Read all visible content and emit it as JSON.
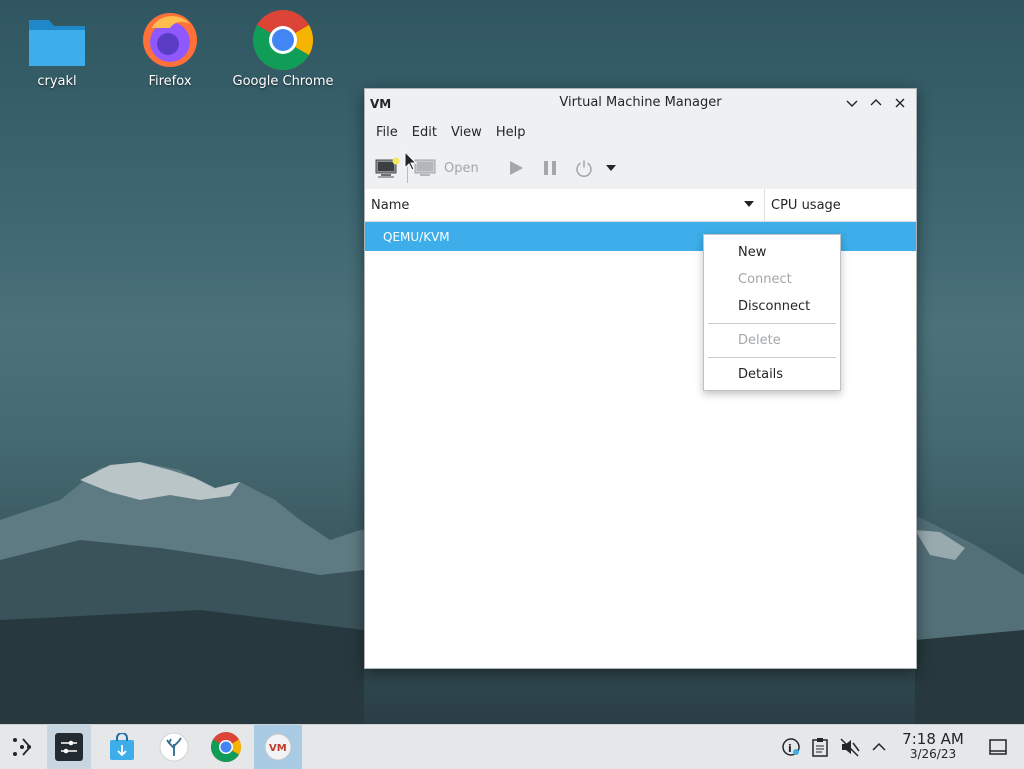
{
  "desktop": {
    "icons": [
      {
        "label": "cryakl",
        "icon": "folder-icon"
      },
      {
        "label": "Firefox",
        "icon": "firefox-icon"
      },
      {
        "label": "Google Chrome",
        "icon": "chrome-icon"
      }
    ]
  },
  "window": {
    "title": "Virtual Machine Manager",
    "app_icon_text": "VM",
    "menubar": [
      "File",
      "Edit",
      "View",
      "Help"
    ],
    "toolbar": {
      "open_label": "Open"
    },
    "columns": {
      "name": "Name",
      "cpu": "CPU usage"
    },
    "rows": [
      {
        "name": "QEMU/KVM",
        "selected": true
      }
    ]
  },
  "context_menu": {
    "items": [
      {
        "label": "New",
        "enabled": true
      },
      {
        "label": "Connect",
        "enabled": false
      },
      {
        "label": "Disconnect",
        "enabled": true
      },
      {
        "label": "Delete",
        "enabled": false
      },
      {
        "label": "Details",
        "enabled": true
      }
    ]
  },
  "taskbar": {
    "clock_time": "7:18 AM",
    "clock_date": "3/26/23",
    "tray_icon_text": "i"
  },
  "colors": {
    "selection": "#3daee9",
    "window_chrome": "#eff0f1",
    "taskbar": "#e5e7e9"
  }
}
